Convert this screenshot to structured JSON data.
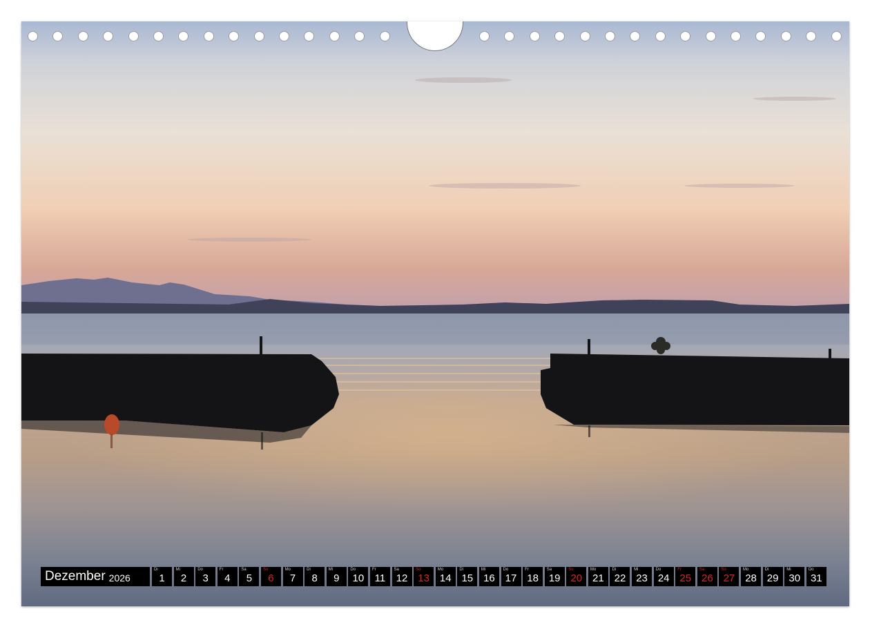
{
  "calendar": {
    "month": "Dezember",
    "year": "2026",
    "days": [
      {
        "wd": "Di",
        "n": "1"
      },
      {
        "wd": "Mi",
        "n": "2"
      },
      {
        "wd": "Do",
        "n": "3"
      },
      {
        "wd": "Fr",
        "n": "4"
      },
      {
        "wd": "Sa",
        "n": "5"
      },
      {
        "wd": "So",
        "n": "6",
        "red": true
      },
      {
        "wd": "Mo",
        "n": "7"
      },
      {
        "wd": "Di",
        "n": "8"
      },
      {
        "wd": "Mi",
        "n": "9"
      },
      {
        "wd": "Do",
        "n": "10"
      },
      {
        "wd": "Fr",
        "n": "11"
      },
      {
        "wd": "Sa",
        "n": "12"
      },
      {
        "wd": "So",
        "n": "13",
        "red": true
      },
      {
        "wd": "Mo",
        "n": "14"
      },
      {
        "wd": "Di",
        "n": "15"
      },
      {
        "wd": "Mi",
        "n": "16"
      },
      {
        "wd": "Do",
        "n": "17"
      },
      {
        "wd": "Fr",
        "n": "18"
      },
      {
        "wd": "Sa",
        "n": "19"
      },
      {
        "wd": "So",
        "n": "20",
        "red": true
      },
      {
        "wd": "Mo",
        "n": "21"
      },
      {
        "wd": "Di",
        "n": "22"
      },
      {
        "wd": "Mi",
        "n": "23"
      },
      {
        "wd": "Do",
        "n": "24"
      },
      {
        "wd": "Fr",
        "n": "25",
        "red": true
      },
      {
        "wd": "Sa",
        "n": "26",
        "red": true
      },
      {
        "wd": "So",
        "n": "27",
        "red": true
      },
      {
        "wd": "Mo",
        "n": "28"
      },
      {
        "wd": "Di",
        "n": "29"
      },
      {
        "wd": "Mi",
        "n": "30"
      },
      {
        "wd": "Do",
        "n": "31"
      }
    ]
  },
  "colors": {
    "holiday": "#d7262b",
    "bar": "#000000"
  }
}
